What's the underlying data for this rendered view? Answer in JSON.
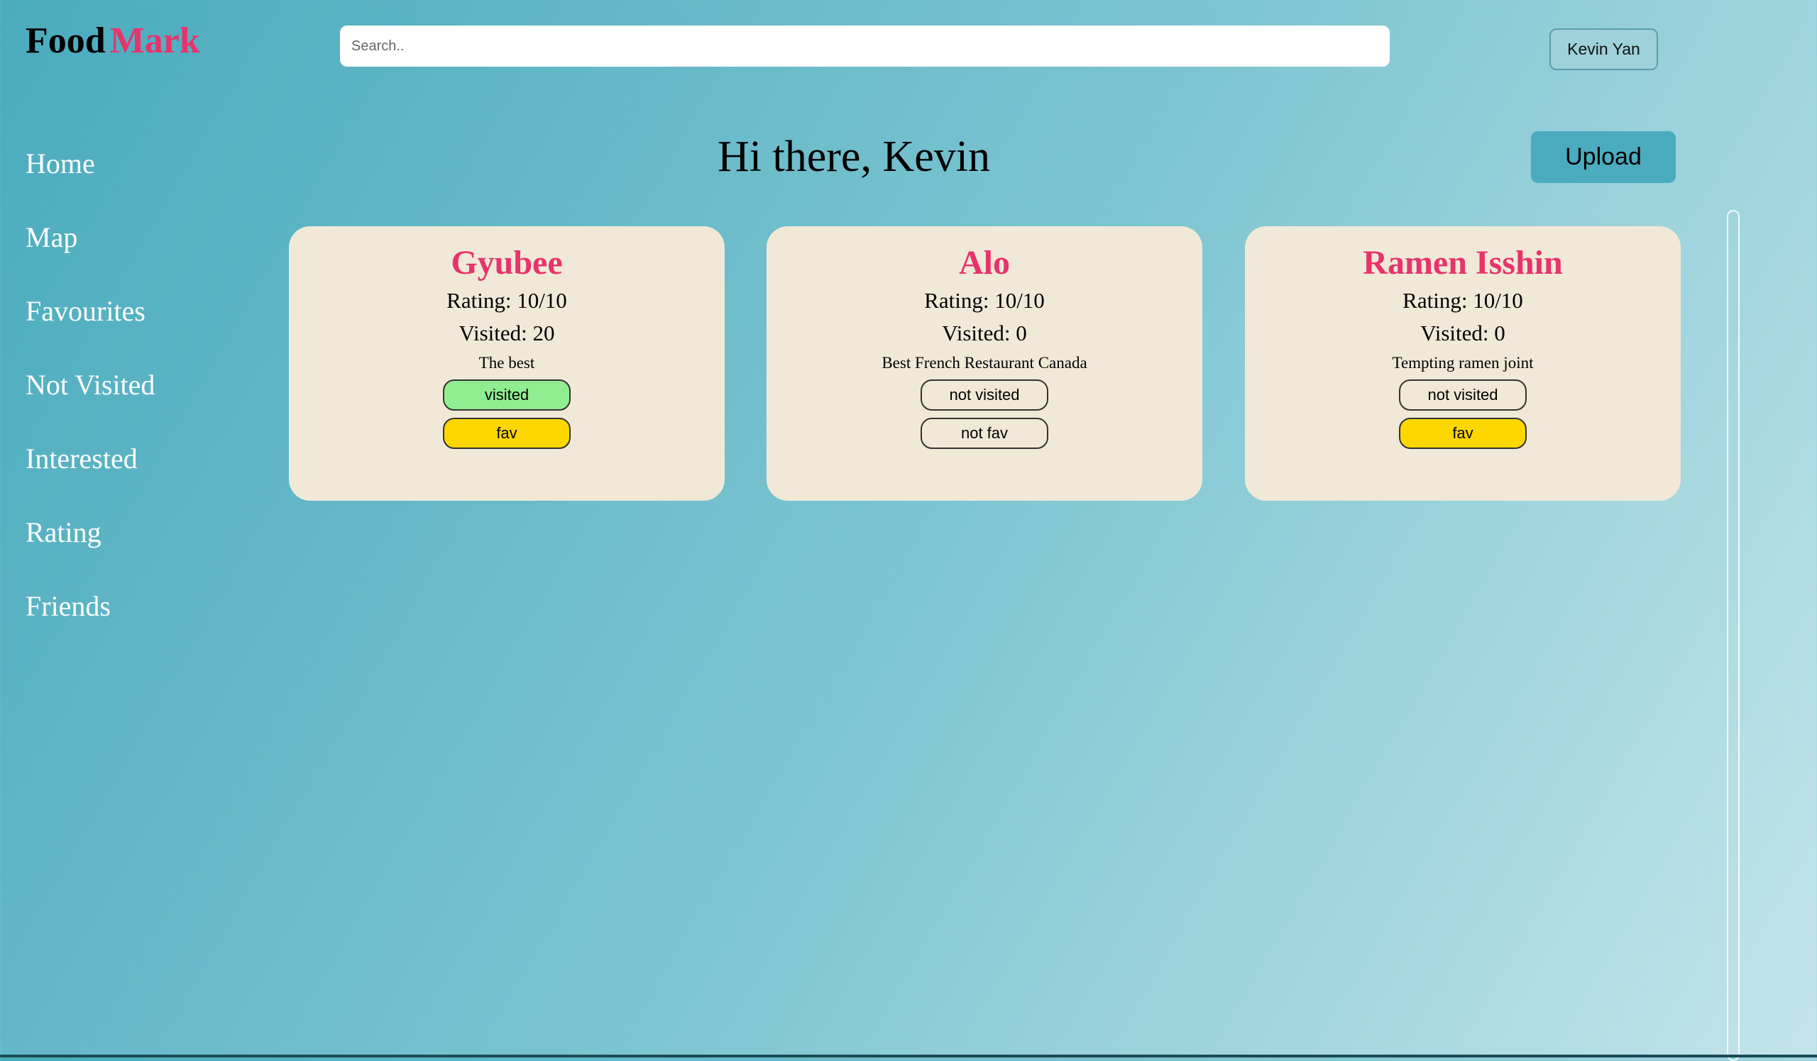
{
  "brand": {
    "part1": "Food",
    "part2": "Mark"
  },
  "search": {
    "placeholder": "Search..",
    "value": ""
  },
  "user": {
    "name": "Kevin Yan"
  },
  "sidebar": {
    "items": [
      {
        "label": "Home"
      },
      {
        "label": "Map"
      },
      {
        "label": "Favourites"
      },
      {
        "label": "Not Visited"
      },
      {
        "label": "Interested"
      },
      {
        "label": "Rating"
      },
      {
        "label": "Friends"
      }
    ]
  },
  "main": {
    "greeting": "Hi there,  Kevin",
    "upload_label": "Upload",
    "cards": [
      {
        "name": "Gyubee",
        "rating": "Rating: 10/10",
        "visited_count": "Visited: 20",
        "description": "The best",
        "visited_label": "visited",
        "fav_label": "fav"
      },
      {
        "name": "Alo",
        "rating": "Rating: 10/10",
        "visited_count": "Visited: 0",
        "description": "Best French Restaurant Canada",
        "visited_label": "not visited",
        "fav_label": "not fav"
      },
      {
        "name": "Ramen Isshin",
        "rating": "Rating: 10/10",
        "visited_count": "Visited: 0",
        "description": "Tempting ramen joint",
        "visited_label": "not visited",
        "fav_label": "fav"
      }
    ]
  },
  "colors": {
    "accent_pink": "#e8336b",
    "card_bg": "#f1e9d7",
    "visited_green": "#90ee90",
    "fav_yellow": "#ffd700",
    "upload_blue": "#4aacbe"
  }
}
